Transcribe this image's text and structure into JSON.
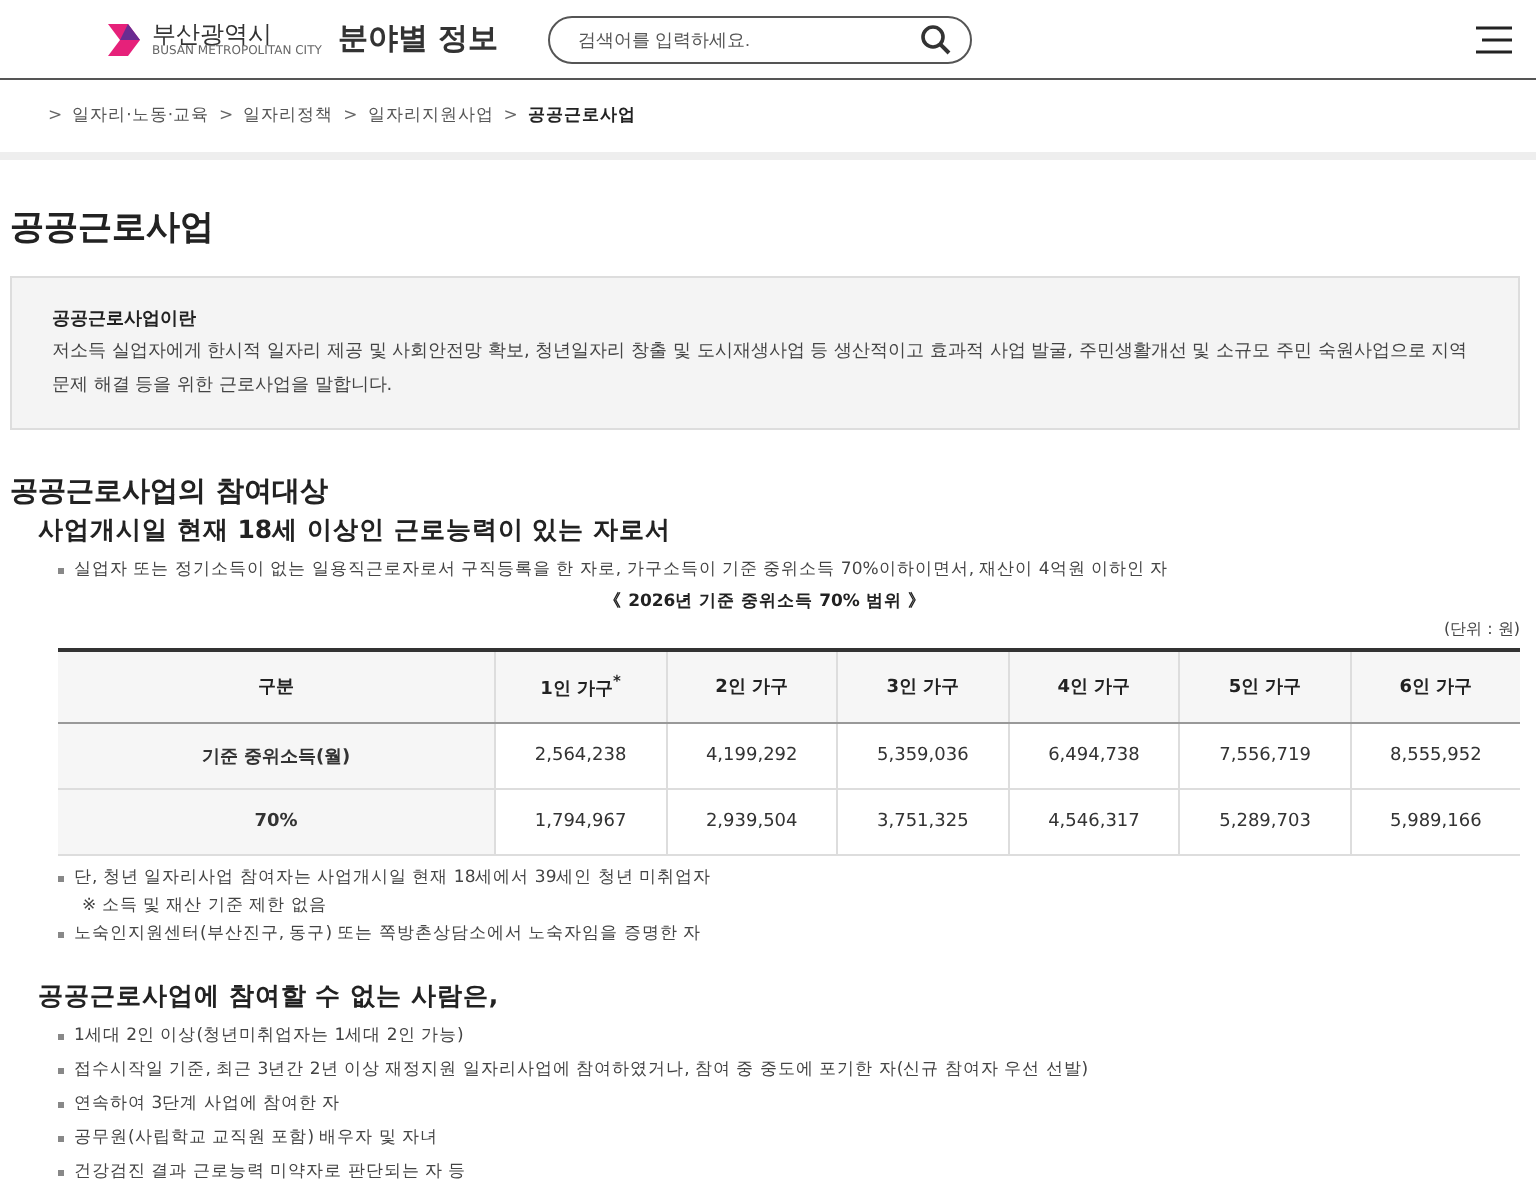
{
  "header": {
    "logo_text": "부산광역시",
    "logo_subtext": "BUSAN METROPOLITAN CITY",
    "title": "분야별 정보",
    "search": {
      "placeholder": "검색어를 입력하세요."
    }
  },
  "breadcrumb": {
    "separator": ">",
    "items": [
      {
        "label": "일자리·노동·교육",
        "current": false
      },
      {
        "label": "일자리정책",
        "current": false
      },
      {
        "label": "일자리지원사업",
        "current": false
      },
      {
        "label": "공공근로사업",
        "current": true
      }
    ]
  },
  "page_title": "공공근로사업",
  "info_box": {
    "title": "공공근로사업이란",
    "text": "저소득 실업자에게 한시적 일자리 제공 및 사회안전망 확보, 청년일자리 창출 및 도시재생사업 등 생산적이고 효과적 사업 발굴, 주민생활개선 및 소규모 주민 숙원사업으로 지역 문제 해결 등을 위한 근로사업을 말합니다."
  },
  "section_title": "공공근로사업의 참여대상",
  "eligible": {
    "heading": "사업개시일 현재 18세 이상인 근로능력이 있는 자로서",
    "note": "실업자 또는 정기소득이 없는 일용직근로자로서 구직등록을 한 자로, 가구소득이 기준 중위소득 70%이하이면서, 재산이 4억원 이하인 자",
    "table_caption": "《 2026년 기준 중위소득 70% 범위 》",
    "unit": "(단위 : 원)",
    "table": {
      "columns": [
        "구분",
        "1인 가구$^{*}$",
        "2인 가구",
        "3인 가구",
        "4인 가구",
        "5인 가구",
        "6인 가구"
      ],
      "rows": [
        [
          "기준 중위소득(월)",
          "2,564,238",
          "4,199,292",
          "5,359,036",
          "6,494,738",
          "7,556,719",
          "8,555,952"
        ],
        [
          "70%",
          "1,794,967",
          "2,939,504",
          "3,751,325",
          "4,546,317",
          "5,289,703",
          "5,989,166"
        ]
      ]
    },
    "notes": [
      {
        "kind": "bullet",
        "text": "단, 청년 일자리사업 참여자는 사업개시일 현재 18세에서 39세인 청년 미취업자"
      },
      {
        "kind": "remark",
        "text": "※ 소득 및 재산 기준 제한 없음"
      },
      {
        "kind": "bullet",
        "text": "노숙인지원센터(부산진구, 동구) 또는 쪽방촌상담소에서 노숙자임을 증명한 자"
      }
    ]
  },
  "ineligible": {
    "heading": "공공근로사업에 참여할 수 없는 사람은,",
    "items": [
      "1세대 2인 이상(청년미취업자는 1세대 2인 가능)",
      "접수시작일 기준, 최근 3년간 2년 이상 재정지원 일자리사업에 참여하였거나, 참여 중 중도에 포기한 자(신규 참여자 우선 선발)",
      "연속하여 3단계 사업에 참여한 자",
      "공무원(사립학교 교직원 포함) 배우자 및 자녀",
      "건강검진 결과 근로능력 미약자로 판단되는 자 등"
    ]
  }
}
